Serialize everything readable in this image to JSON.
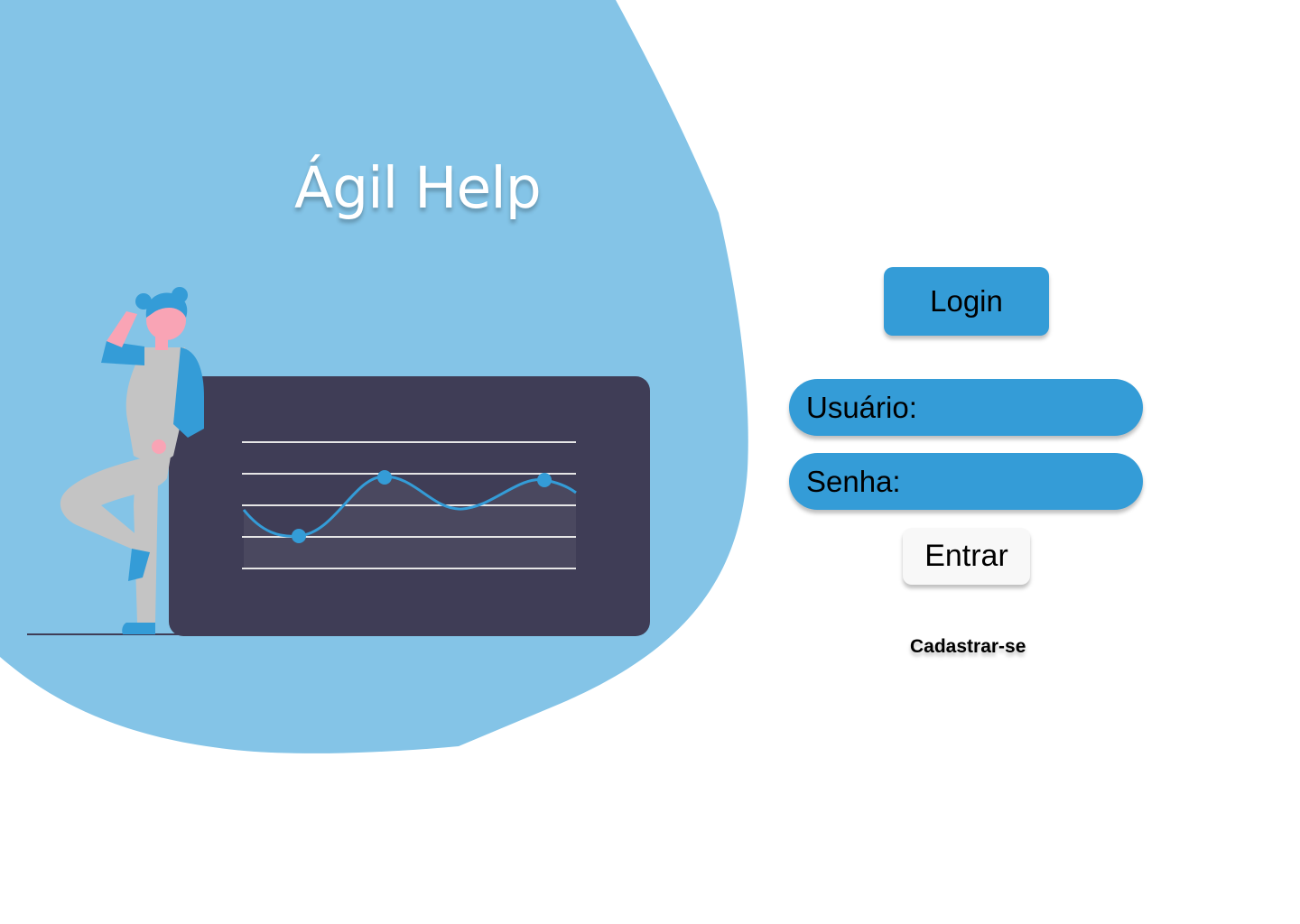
{
  "app": {
    "title": "Ágil Help"
  },
  "login": {
    "badge_label": "Login",
    "username_label": "Usuário:",
    "username_value": "",
    "password_label": "Senha:",
    "password_value": "",
    "submit_label": "Entrar",
    "register_label": "Cadastrar-se"
  },
  "colors": {
    "background_blob": "#84C4E7",
    "accent": "#349CD7",
    "illustration_panel": "#3F3D56",
    "button_light": "#F8F8F8",
    "person_clothes": "#C4C4C4",
    "person_skin": "#F9A4B5"
  },
  "icons": {
    "illustration": "woman-with-line-chart-board"
  }
}
